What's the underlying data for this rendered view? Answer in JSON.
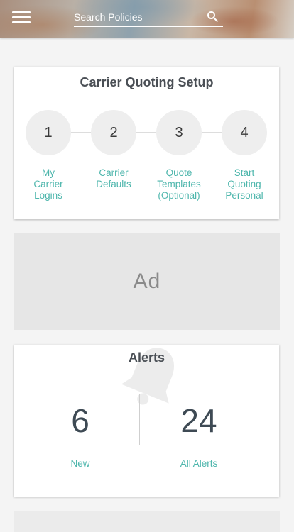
{
  "header": {
    "search": {
      "placeholder": "Search Policies",
      "value": "",
      "icon": "search-icon"
    },
    "menu_icon": "hamburger-menu-icon"
  },
  "setup": {
    "title": "Carrier Quoting Setup",
    "steps": [
      {
        "number": "1",
        "label": "My\nCarrier\nLogins"
      },
      {
        "number": "2",
        "label": "Carrier\nDefaults"
      },
      {
        "number": "3",
        "label": "Quote\nTemplates\n(Optional)"
      },
      {
        "number": "4",
        "label": "Start\nQuoting\nPersonal"
      }
    ]
  },
  "ad": {
    "label": "Ad"
  },
  "alerts": {
    "title": "Alerts",
    "new": {
      "count": "6",
      "label": "New"
    },
    "all": {
      "count": "24",
      "label": "All Alerts"
    }
  },
  "colors": {
    "accent": "#4db6ac",
    "text_dark": "#4a4f55",
    "background": "#f4f4f4"
  }
}
